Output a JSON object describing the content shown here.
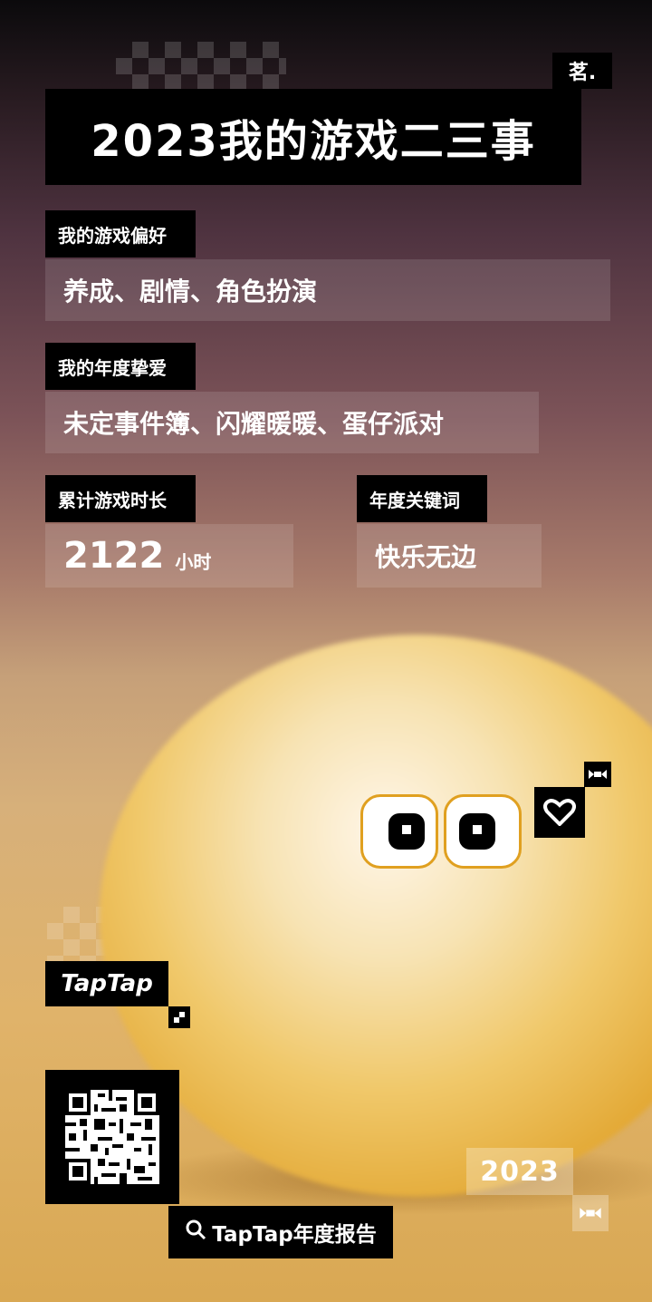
{
  "header": {
    "title": "2023我的游戏二三事",
    "signature": "茗."
  },
  "preference": {
    "label": "我的游戏偏好",
    "value": "养成、剧情、角色扮演"
  },
  "favorite": {
    "label": "我的年度挚爱",
    "value": "未定事件簿、闪耀暖暖、蛋仔派对"
  },
  "playtime": {
    "label": "累计游戏时长",
    "value": "2122",
    "unit": "小时"
  },
  "keyword": {
    "label": "年度关键词",
    "value": "快乐无边"
  },
  "brand": {
    "logo": "TapTap"
  },
  "footer": {
    "search_label": "TapTap年度报告",
    "year": "2023"
  }
}
